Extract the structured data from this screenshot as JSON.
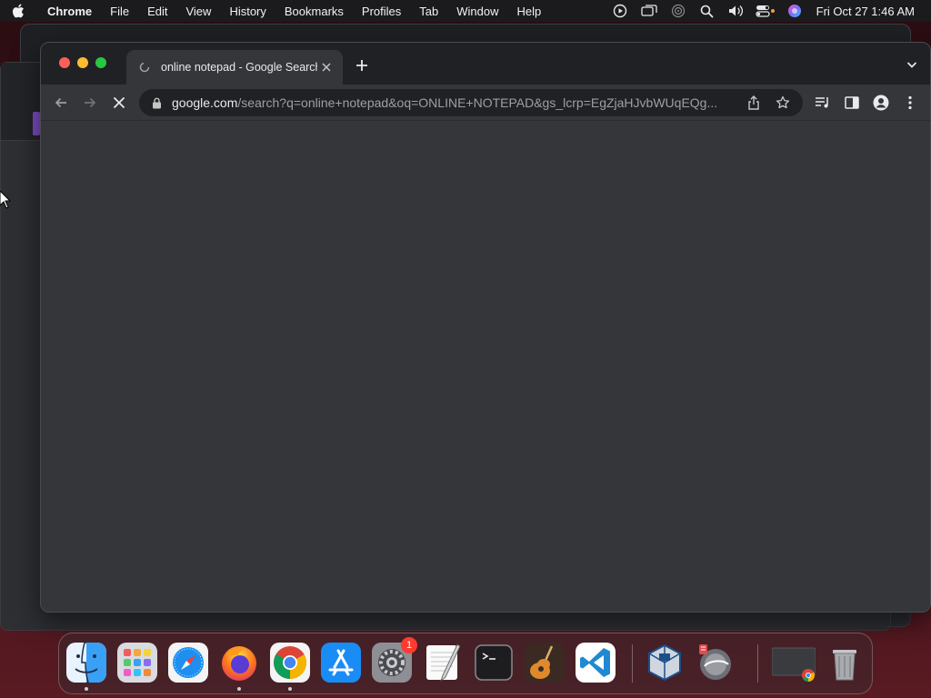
{
  "menubar": {
    "app_name": "Chrome",
    "menus": [
      "File",
      "Edit",
      "View",
      "History",
      "Bookmarks",
      "Profiles",
      "Tab",
      "Window",
      "Help"
    ],
    "clock": "Fri Oct 27  1:46 AM"
  },
  "browser": {
    "tab_title": "online notepad - Google Search",
    "url_host": "google.com",
    "url_path": "/search?q=online+notepad&oq=ONLINE+NOTEPAD&gs_lcrp=EgZjaHJvbWUqEQg..."
  },
  "dock": {
    "apps": [
      "Finder",
      "Launchpad",
      "Safari",
      "Firefox",
      "Chrome",
      "App Store",
      "System Settings",
      "TextEdit",
      "Terminal",
      "GarageBand",
      "Visual Studio Code",
      "VirtualBox",
      "Disk Utility",
      "Chrome window",
      "Trash"
    ],
    "settings_badge": "1"
  },
  "colors": {
    "menubar_bg": "#1b1b1d",
    "tabstrip_bg": "#202124",
    "toolbar_bg": "#35363a",
    "omnibox_bg": "#202124",
    "close_red": "#ff5f57",
    "minimize_yellow": "#febc2e",
    "maximize_green": "#28c840"
  }
}
